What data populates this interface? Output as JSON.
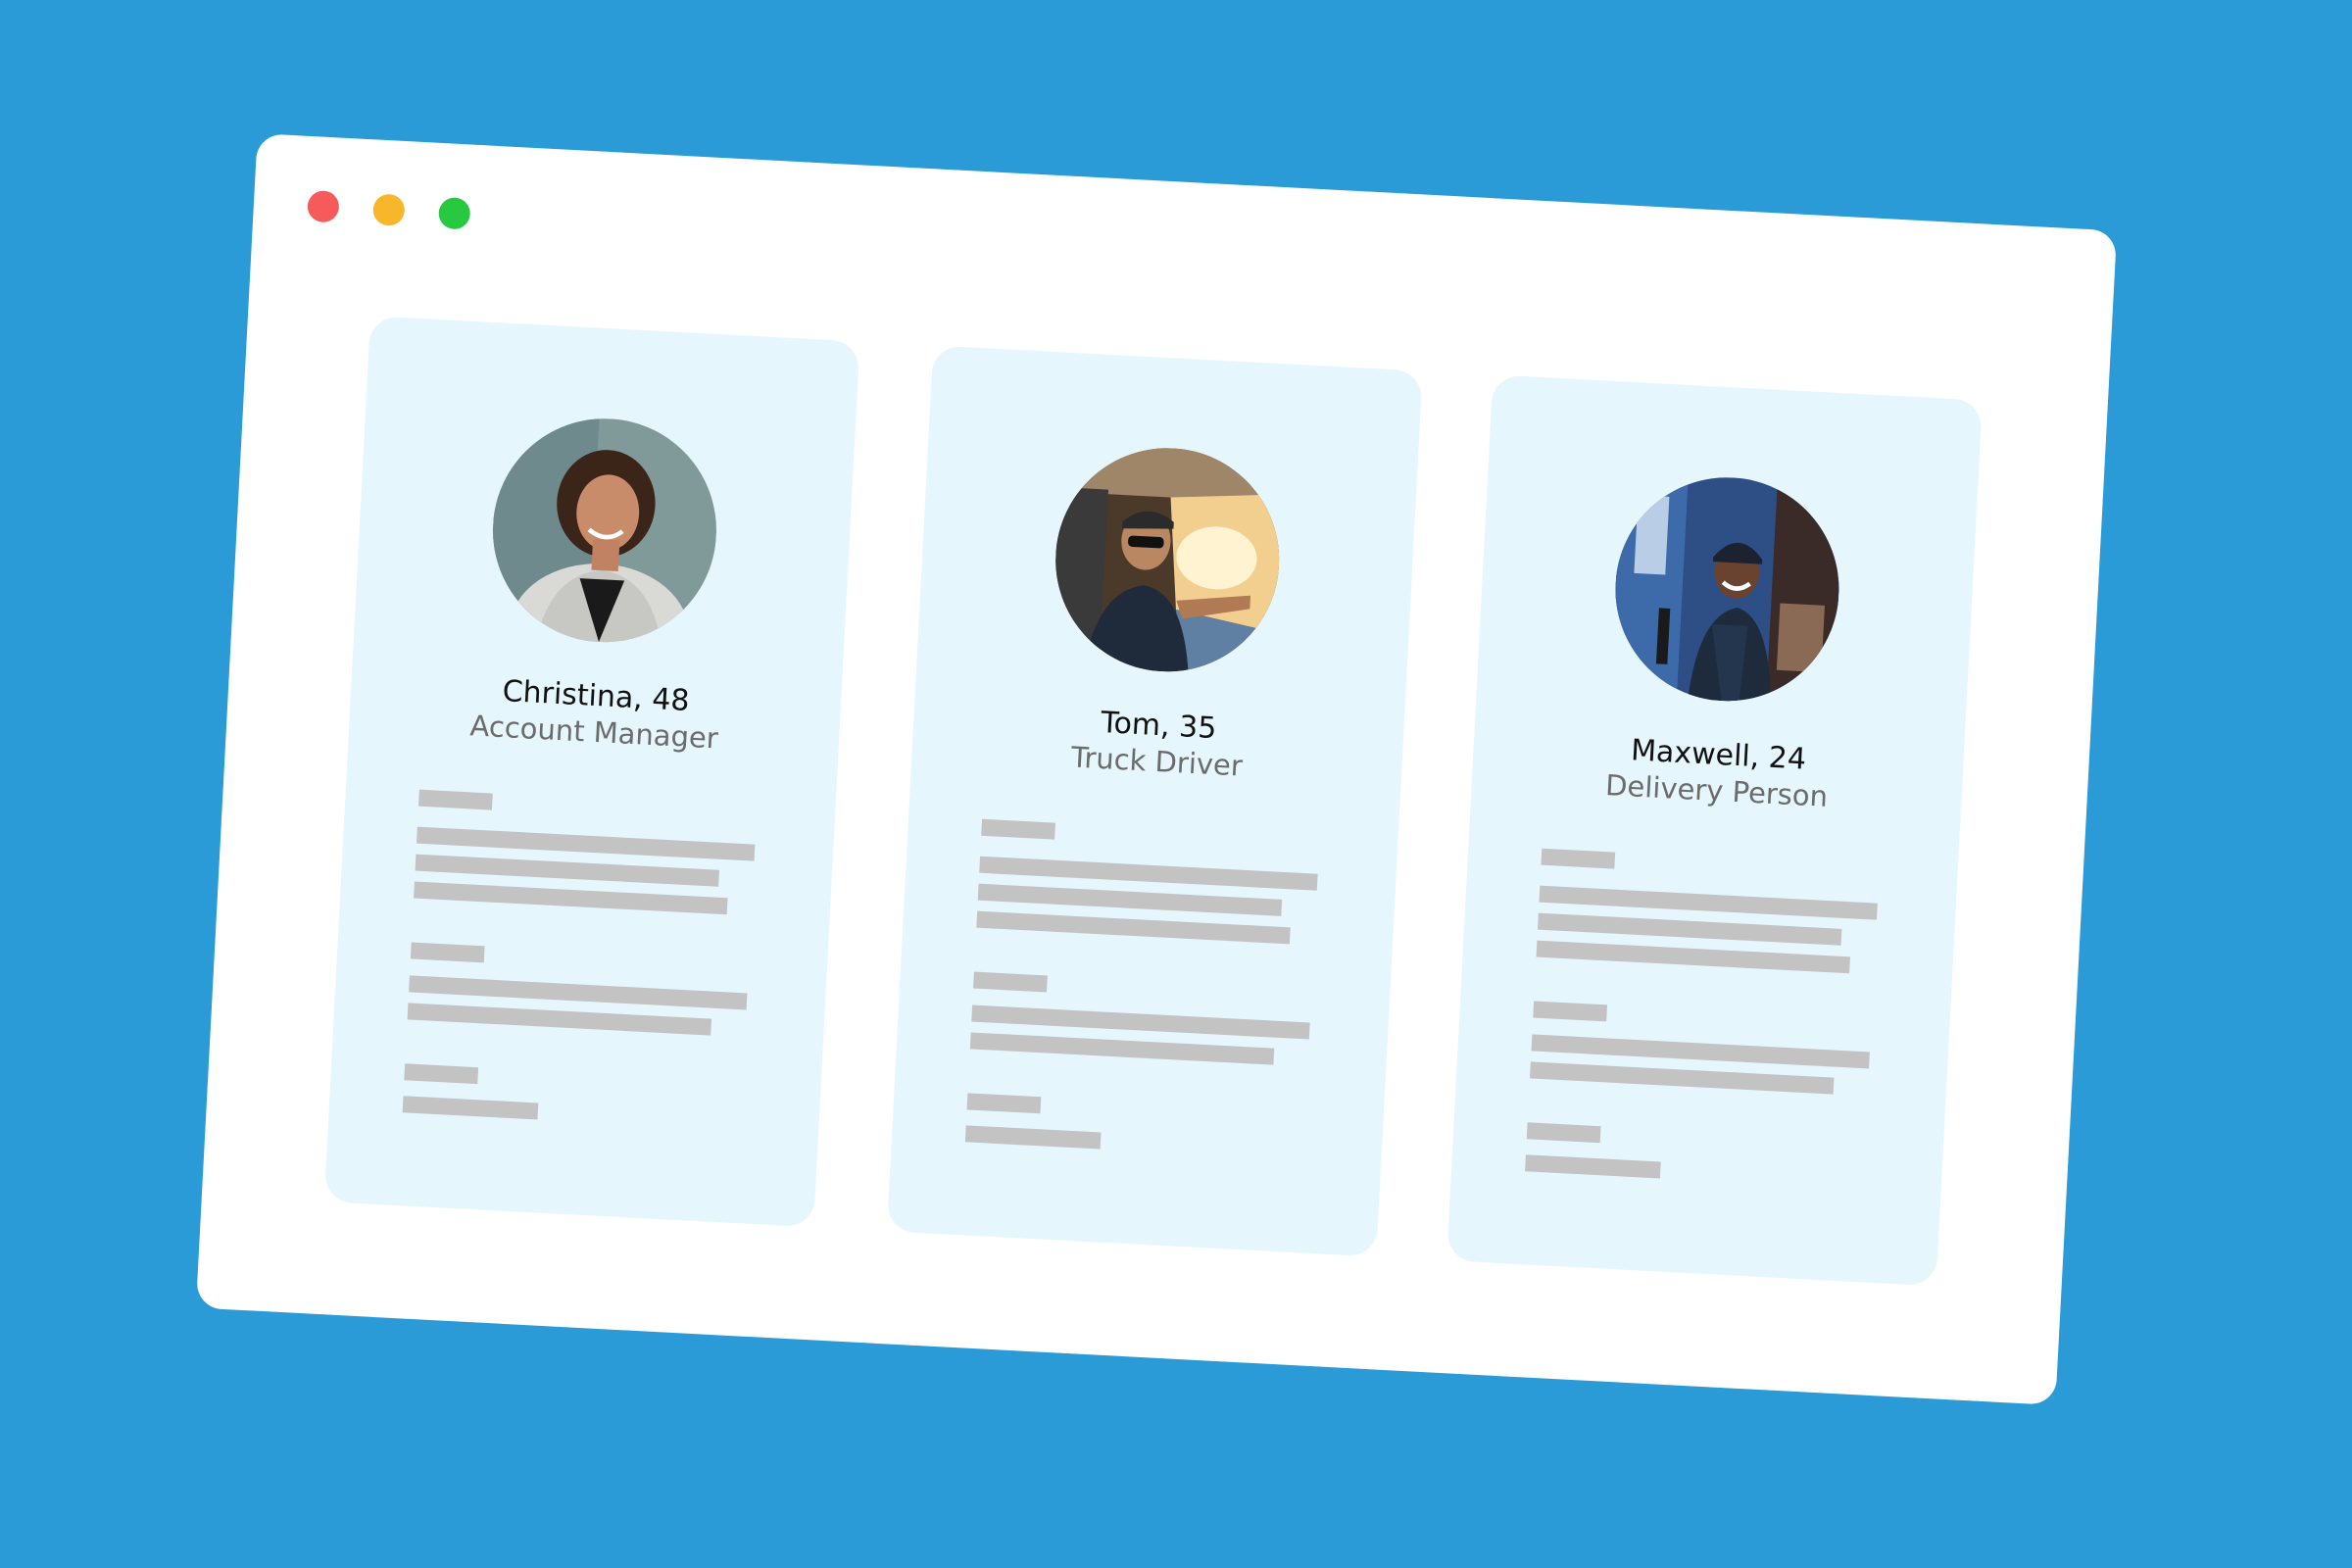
{
  "window": {
    "controls": [
      {
        "name": "close",
        "color": "#f65a5b"
      },
      {
        "name": "minimize",
        "color": "#f8b62b"
      },
      {
        "name": "maximize",
        "color": "#28c840"
      }
    ]
  },
  "personas": [
    {
      "name_age": "Christina, 48",
      "role": "Account Manager",
      "photo": "woman-professional-portrait"
    },
    {
      "name_age": "Tom, 35",
      "role": "Truck Driver",
      "photo": "man-driving-truck"
    },
    {
      "name_age": "Maxwell, 24",
      "role": "Delivery Person",
      "photo": "man-delivery-street"
    }
  ],
  "colors": {
    "background": "#2a9bd6",
    "window": "#ffffff",
    "card": "#e6f6fd",
    "placeholder": "#c3c3c3"
  }
}
